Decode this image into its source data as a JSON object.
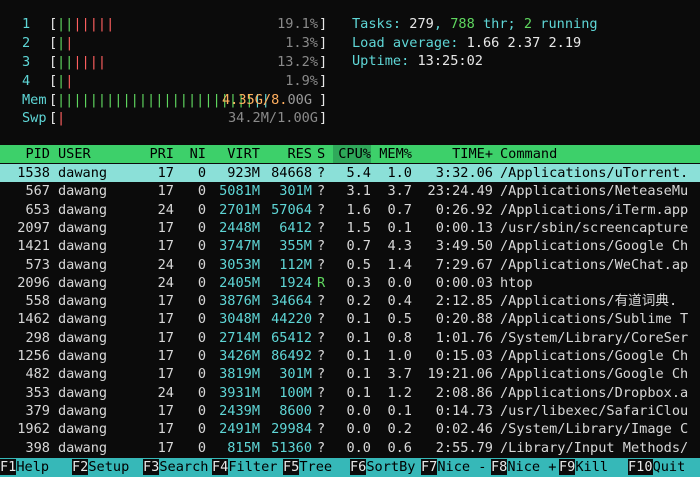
{
  "meters": {
    "cpus": [
      {
        "num": "1",
        "bars": [
          {
            "t": "||",
            "c": "green"
          },
          {
            "t": "|||||",
            "c": "red"
          }
        ],
        "pct": "19.1%",
        "fill": 0.191
      },
      {
        "num": "2",
        "bars": [
          {
            "t": "|",
            "c": "green"
          },
          {
            "t": "|",
            "c": "red"
          }
        ],
        "pct": "1.3%",
        "fill": 0.013
      },
      {
        "num": "3",
        "bars": [
          {
            "t": "||",
            "c": "green"
          },
          {
            "t": "||||",
            "c": "red"
          }
        ],
        "pct": "13.2%",
        "fill": 0.132
      },
      {
        "num": "4",
        "bars": [
          {
            "t": "|",
            "c": "green"
          },
          {
            "t": "|",
            "c": "red"
          }
        ],
        "pct": "1.9%",
        "fill": 0.019
      }
    ],
    "mem": {
      "label": "Mem",
      "bars": [
        {
          "t": "||||||||||||||||||||||||",
          "c": "green"
        },
        {
          "t": "||",
          "c": "cyan"
        }
      ],
      "text_hi": "4.35G/8.",
      "text_lo": "00G",
      "fill": 0.54
    },
    "swp": {
      "label": "Swp",
      "bars": [
        {
          "t": "|",
          "c": "red"
        }
      ],
      "text": "34.2M/1.00G",
      "fill": 0.034
    }
  },
  "summary": {
    "tasks_label": "Tasks: ",
    "tasks": "279",
    "thr_sep": ", ",
    "thr": "788",
    "thr_label": " thr; ",
    "running": "2",
    "running_label": " running",
    "load_label": "Load average: ",
    "load1": "1.66",
    "load5": "2.37",
    "load15": "2.19",
    "uptime_label": "Uptime: ",
    "uptime": "13:25:02"
  },
  "table": {
    "headers": {
      "pid": "PID",
      "user": "USER",
      "pri": "PRI",
      "ni": "NI",
      "virt": "VIRT",
      "res": "RES",
      "s": "S",
      "cpu": "CPU%",
      "mem": "MEM%",
      "time": "TIME+",
      "cmd": "Command"
    },
    "rows": [
      {
        "pid": "1538",
        "user": "dawang",
        "pri": "17",
        "ni": "0",
        "virt": "923M",
        "res": "84668",
        "s": "?",
        "cpu": "5.4",
        "mem": "1.0",
        "time": "3:32.06",
        "cmd": "/Applications/uTorrent.",
        "selected": true
      },
      {
        "pid": "567",
        "user": "dawang",
        "pri": "17",
        "ni": "0",
        "virt": "5081M",
        "res": "301M",
        "s": "?",
        "cpu": "3.1",
        "mem": "3.7",
        "time": "23:24.49",
        "cmd": "/Applications/NeteaseMu"
      },
      {
        "pid": "653",
        "user": "dawang",
        "pri": "24",
        "ni": "0",
        "virt": "2701M",
        "res": "57064",
        "s": "?",
        "cpu": "1.6",
        "mem": "0.7",
        "time": "0:26.92",
        "cmd": "/Applications/iTerm.app"
      },
      {
        "pid": "2097",
        "user": "dawang",
        "pri": "17",
        "ni": "0",
        "virt": "2448M",
        "res": "6412",
        "s": "?",
        "cpu": "1.5",
        "mem": "0.1",
        "time": "0:00.13",
        "cmd": "/usr/sbin/screencapture"
      },
      {
        "pid": "1421",
        "user": "dawang",
        "pri": "17",
        "ni": "0",
        "virt": "3747M",
        "res": "355M",
        "s": "?",
        "cpu": "0.7",
        "mem": "4.3",
        "time": "3:49.50",
        "cmd": "/Applications/Google Ch"
      },
      {
        "pid": "573",
        "user": "dawang",
        "pri": "24",
        "ni": "0",
        "virt": "3053M",
        "res": "112M",
        "s": "?",
        "cpu": "0.5",
        "mem": "1.4",
        "time": "7:29.67",
        "cmd": "/Applications/WeChat.ap"
      },
      {
        "pid": "2096",
        "user": "dawang",
        "pri": "24",
        "ni": "0",
        "virt": "2405M",
        "res": "1924",
        "s": "R",
        "cpu": "0.3",
        "mem": "0.0",
        "time": "0:00.03",
        "cmd": "htop"
      },
      {
        "pid": "558",
        "user": "dawang",
        "pri": "17",
        "ni": "0",
        "virt": "3876M",
        "res": "34664",
        "s": "?",
        "cpu": "0.2",
        "mem": "0.4",
        "time": "2:12.85",
        "cmd": "/Applications/有道词典."
      },
      {
        "pid": "1462",
        "user": "dawang",
        "pri": "17",
        "ni": "0",
        "virt": "3048M",
        "res": "44220",
        "s": "?",
        "cpu": "0.1",
        "mem": "0.5",
        "time": "0:20.88",
        "cmd": "/Applications/Sublime T"
      },
      {
        "pid": "298",
        "user": "dawang",
        "pri": "17",
        "ni": "0",
        "virt": "2714M",
        "res": "65412",
        "s": "?",
        "cpu": "0.1",
        "mem": "0.8",
        "time": "1:01.76",
        "cmd": "/System/Library/CoreSer"
      },
      {
        "pid": "1256",
        "user": "dawang",
        "pri": "17",
        "ni": "0",
        "virt": "3426M",
        "res": "86492",
        "s": "?",
        "cpu": "0.1",
        "mem": "1.0",
        "time": "0:15.03",
        "cmd": "/Applications/Google Ch"
      },
      {
        "pid": "482",
        "user": "dawang",
        "pri": "17",
        "ni": "0",
        "virt": "3819M",
        "res": "301M",
        "s": "?",
        "cpu": "0.1",
        "mem": "3.7",
        "time": "19:21.06",
        "cmd": "/Applications/Google Ch"
      },
      {
        "pid": "353",
        "user": "dawang",
        "pri": "24",
        "ni": "0",
        "virt": "3931M",
        "res": "100M",
        "s": "?",
        "cpu": "0.1",
        "mem": "1.2",
        "time": "2:08.86",
        "cmd": "/Applications/Dropbox.a"
      },
      {
        "pid": "379",
        "user": "dawang",
        "pri": "17",
        "ni": "0",
        "virt": "2439M",
        "res": "8600",
        "s": "?",
        "cpu": "0.0",
        "mem": "0.1",
        "time": "0:14.73",
        "cmd": "/usr/libexec/SafariClou"
      },
      {
        "pid": "1962",
        "user": "dawang",
        "pri": "17",
        "ni": "0",
        "virt": "2491M",
        "res": "29984",
        "s": "?",
        "cpu": "0.0",
        "mem": "0.2",
        "time": "0:02.46",
        "cmd": "/System/Library/Image C"
      },
      {
        "pid": "398",
        "user": "dawang",
        "pri": "17",
        "ni": "0",
        "virt": "815M",
        "res": "51360",
        "s": "?",
        "cpu": "0.0",
        "mem": "0.6",
        "time": "2:55.79",
        "cmd": "/Library/Input Methods/"
      }
    ]
  },
  "footer": [
    {
      "key": "F1",
      "label": "Help"
    },
    {
      "key": "F2",
      "label": "Setup"
    },
    {
      "key": "F3",
      "label": "Search"
    },
    {
      "key": "F4",
      "label": "Filter"
    },
    {
      "key": "F5",
      "label": "Tree"
    },
    {
      "key": "F6",
      "label": "SortBy"
    },
    {
      "key": "F7",
      "label": "Nice -"
    },
    {
      "key": "F8",
      "label": "Nice +"
    },
    {
      "key": "F9",
      "label": "Kill"
    },
    {
      "key": "F10",
      "label": "Quit"
    }
  ],
  "colors": {
    "header_bg": "#3dd06a",
    "selected_row_bg": "#8be0d8",
    "footer_label_bg": "#36b8b8",
    "background": "#0b0b0b"
  }
}
